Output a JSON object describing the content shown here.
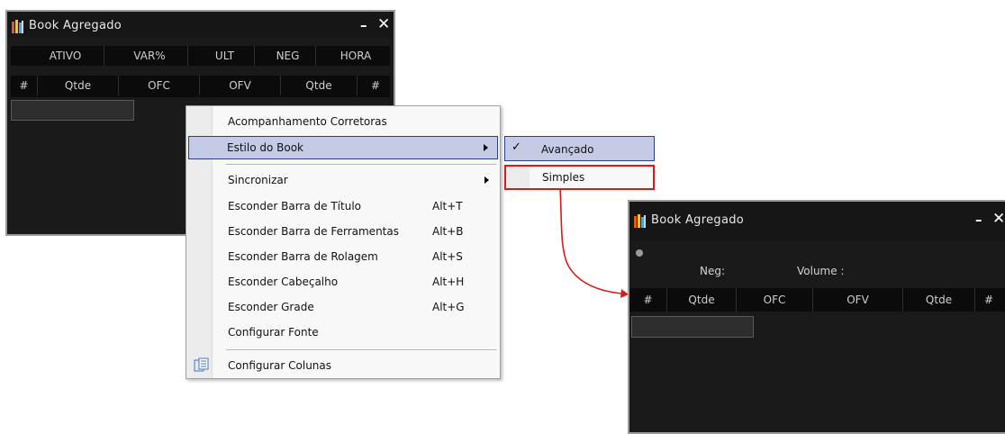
{
  "window_advanced": {
    "title": "Book Agregado",
    "header_row1": [
      "ATIVO",
      "VAR%",
      "ULT",
      "NEG",
      "HORA"
    ],
    "header_row2": [
      "#",
      "Qtde",
      "OFC",
      "OFV",
      "Qtde",
      "#"
    ]
  },
  "context_menu": {
    "items": [
      {
        "label": "Acompanhamento Corretoras",
        "shortcut": ""
      },
      {
        "label": "Estilo do Book",
        "shortcut": ""
      },
      {
        "label": "Sincronizar",
        "shortcut": ""
      },
      {
        "label": "Esconder Barra de Título",
        "shortcut": "Alt+T"
      },
      {
        "label": "Esconder Barra de Ferramentas",
        "shortcut": "Alt+B"
      },
      {
        "label": "Esconder Barra de Rolagem",
        "shortcut": "Alt+S"
      },
      {
        "label": "Esconder Cabeçalho",
        "shortcut": "Alt+H"
      },
      {
        "label": "Esconder Grade",
        "shortcut": "Alt+G"
      },
      {
        "label": "Configurar Fonte",
        "shortcut": ""
      },
      {
        "label": "Configurar Colunas",
        "shortcut": ""
      }
    ]
  },
  "submenu": {
    "items": [
      {
        "label": "Avançado",
        "checked": true
      },
      {
        "label": "Simples",
        "checked": false
      }
    ]
  },
  "window_simple": {
    "title": "Book Agregado",
    "neg_label": "Neg:",
    "volume_label": "Volume :",
    "header": [
      "#",
      "Qtde",
      "OFC",
      "OFV",
      "Qtde",
      "#"
    ]
  },
  "icons": {
    "book": "book-icon",
    "minimize": "minimize-icon",
    "close": "close-icon",
    "check": "check-icon",
    "submenu_arrow": "arrow-right-icon",
    "columns": "columns-config-icon"
  },
  "colors": {
    "window_bg": "#1a1a1a",
    "highlight": "#c5cbe4",
    "highlight_border": "#2c3f8a",
    "annotation_red": "#d81a1a"
  }
}
